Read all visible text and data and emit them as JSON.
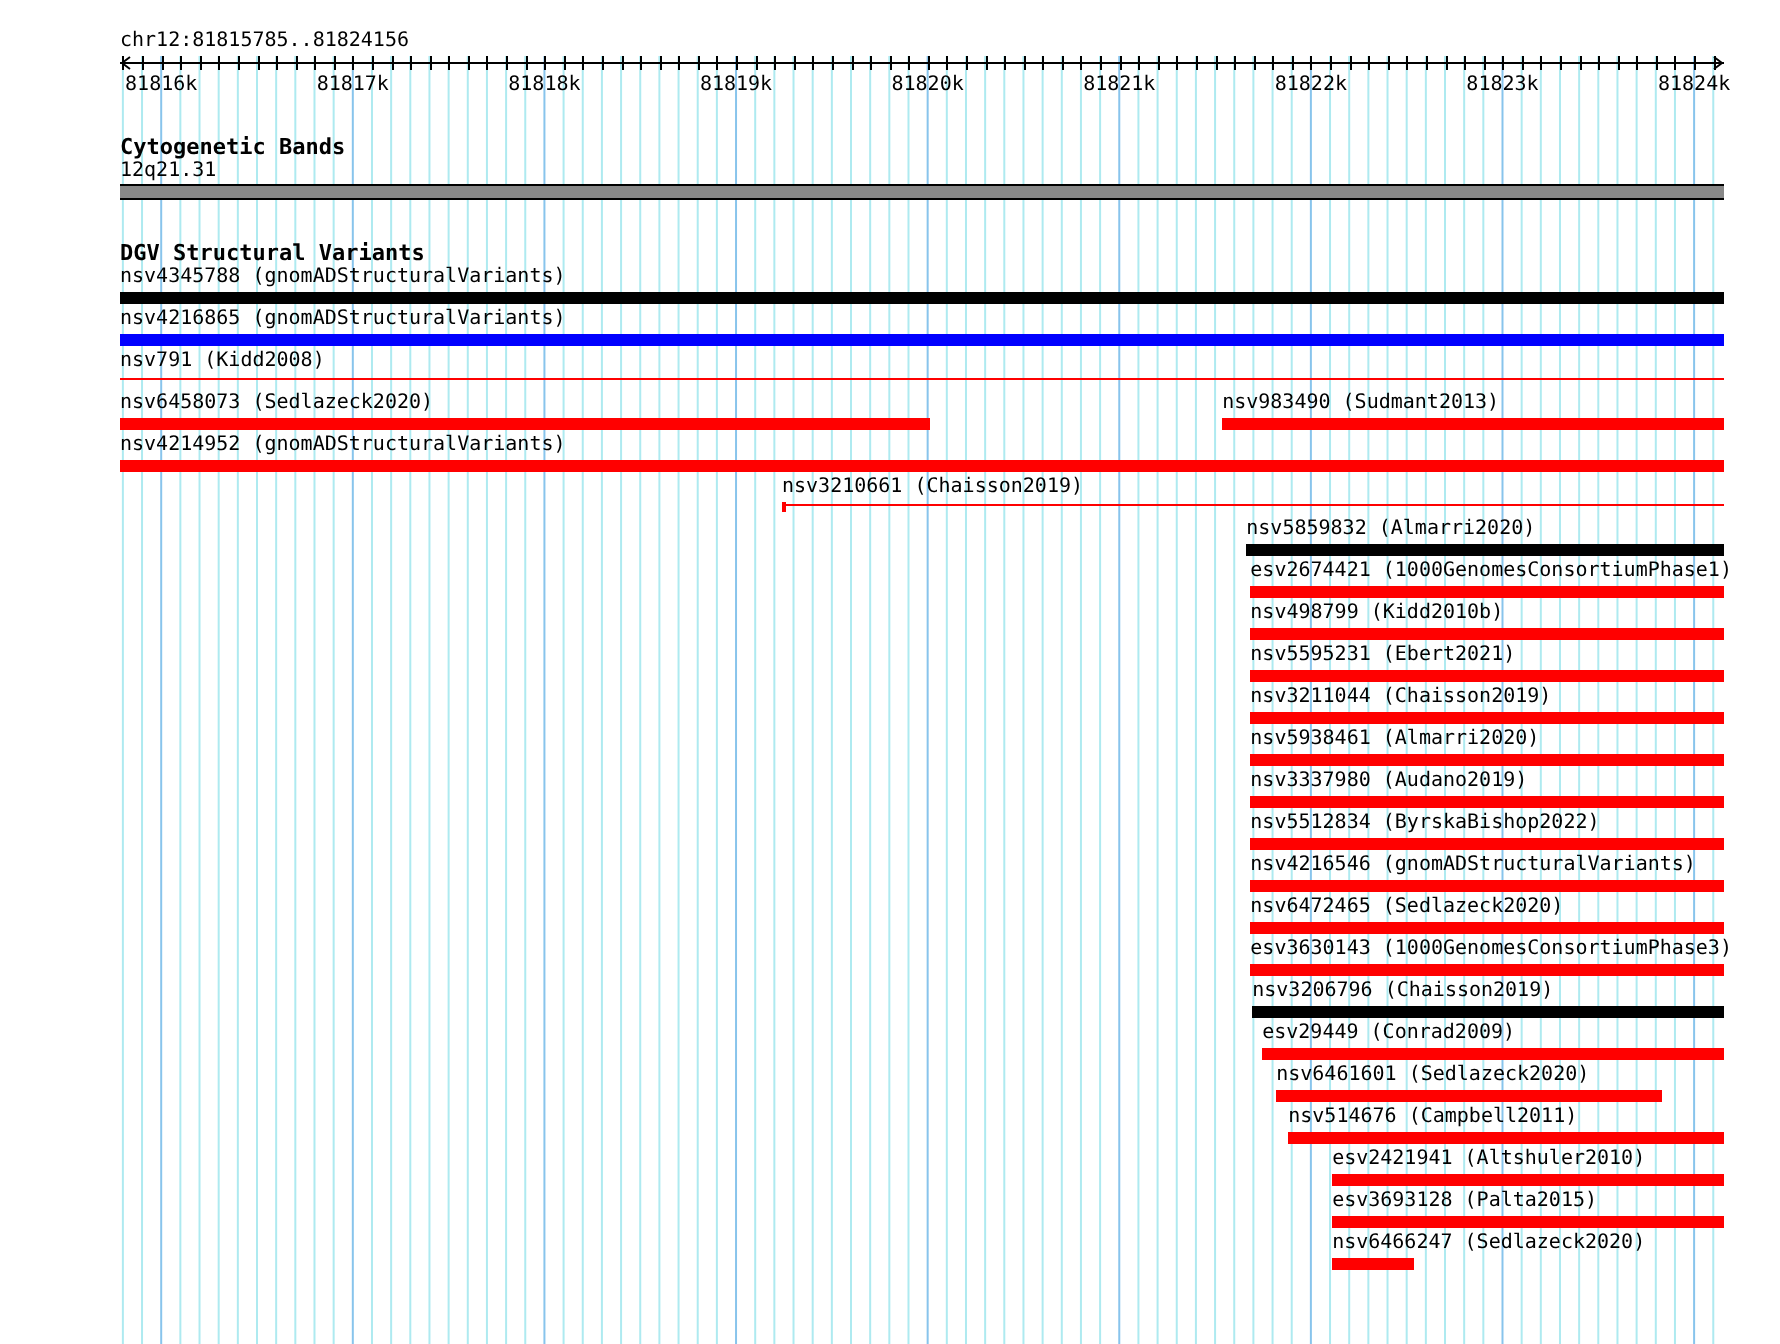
{
  "location": "chr12:81815785..81824156",
  "ruler": {
    "ticks": [
      "81816k",
      "81817k",
      "81818k",
      "81819k",
      "81820k",
      "81821k",
      "81822k",
      "81823k",
      "81824k"
    ]
  },
  "cytoband_track": {
    "title": "Cytogenetic Bands",
    "band": {
      "label": "12q21.31",
      "color": "#888888"
    }
  },
  "sv_track": {
    "title": "DGV Structural Variants",
    "rows": [
      {
        "features": [
          {
            "label": "nsv4345788 (gnomADStructuralVariants)",
            "kind": "bar",
            "color": "#000000"
          }
        ]
      },
      {
        "features": [
          {
            "label": "nsv4216865 (gnomADStructuralVariants)",
            "kind": "bar",
            "color": "#0000ff"
          }
        ]
      },
      {
        "features": [
          {
            "label": "nsv791 (Kidd2008)",
            "kind": "line",
            "color": "#ff0000"
          }
        ]
      },
      {
        "features": [
          {
            "label": "nsv6458073 (Sedlazeck2020)",
            "kind": "bar",
            "color": "#ff0000"
          },
          {
            "label": "nsv983490 (Sudmant2013)",
            "kind": "bar",
            "color": "#ff0000"
          }
        ]
      },
      {
        "features": [
          {
            "label": "nsv4214952 (gnomADStructuralVariants)",
            "kind": "bar",
            "color": "#ff0000"
          }
        ]
      },
      {
        "features": [
          {
            "label": "nsv3210661 (Chaisson2019)",
            "kind": "line",
            "color": "#ff0000"
          }
        ]
      },
      {
        "features": [
          {
            "label": "nsv5859832 (Almarri2020)",
            "kind": "bar",
            "color": "#000000"
          }
        ]
      },
      {
        "features": [
          {
            "label": "esv2674421 (1000GenomesConsortiumPhase1)",
            "kind": "bar",
            "color": "#ff0000"
          }
        ]
      },
      {
        "features": [
          {
            "label": "nsv498799 (Kidd2010b)",
            "kind": "bar",
            "color": "#ff0000"
          }
        ]
      },
      {
        "features": [
          {
            "label": "nsv5595231 (Ebert2021)",
            "kind": "bar",
            "color": "#ff0000"
          }
        ]
      },
      {
        "features": [
          {
            "label": "nsv3211044 (Chaisson2019)",
            "kind": "bar",
            "color": "#ff0000"
          }
        ]
      },
      {
        "features": [
          {
            "label": "nsv5938461 (Almarri2020)",
            "kind": "bar",
            "color": "#ff0000"
          }
        ]
      },
      {
        "features": [
          {
            "label": "nsv3337980 (Audano2019)",
            "kind": "bar",
            "color": "#ff0000"
          }
        ]
      },
      {
        "features": [
          {
            "label": "nsv5512834 (ByrskaBishop2022)",
            "kind": "bar",
            "color": "#ff0000"
          }
        ]
      },
      {
        "features": [
          {
            "label": "nsv4216546 (gnomADStructuralVariants)",
            "kind": "bar",
            "color": "#ff0000"
          }
        ]
      },
      {
        "features": [
          {
            "label": "nsv6472465 (Sedlazeck2020)",
            "kind": "bar",
            "color": "#ff0000"
          }
        ]
      },
      {
        "features": [
          {
            "label": "esv3630143 (1000GenomesConsortiumPhase3)",
            "kind": "bar",
            "color": "#ff0000"
          }
        ]
      },
      {
        "features": [
          {
            "label": "nsv3206796 (Chaisson2019)",
            "kind": "bar",
            "color": "#000000"
          }
        ]
      },
      {
        "features": [
          {
            "label": "esv29449 (Conrad2009)",
            "kind": "bar",
            "color": "#ff0000"
          }
        ]
      },
      {
        "features": [
          {
            "label": "nsv6461601 (Sedlazeck2020)",
            "kind": "bar",
            "color": "#ff0000"
          }
        ]
      },
      {
        "features": [
          {
            "label": "nsv514676 (Campbell2011)",
            "kind": "bar",
            "color": "#ff0000"
          }
        ]
      },
      {
        "features": [
          {
            "label": "esv2421941 (Altshuler2010)",
            "kind": "bar",
            "color": "#ff0000"
          }
        ]
      },
      {
        "features": [
          {
            "label": "esv3693128 (Palta2015)",
            "kind": "bar",
            "color": "#ff0000"
          }
        ]
      },
      {
        "features": [
          {
            "label": "nsv6466247 (Sedlazeck2020)",
            "kind": "bar",
            "color": "#ff0000"
          }
        ]
      }
    ]
  }
}
